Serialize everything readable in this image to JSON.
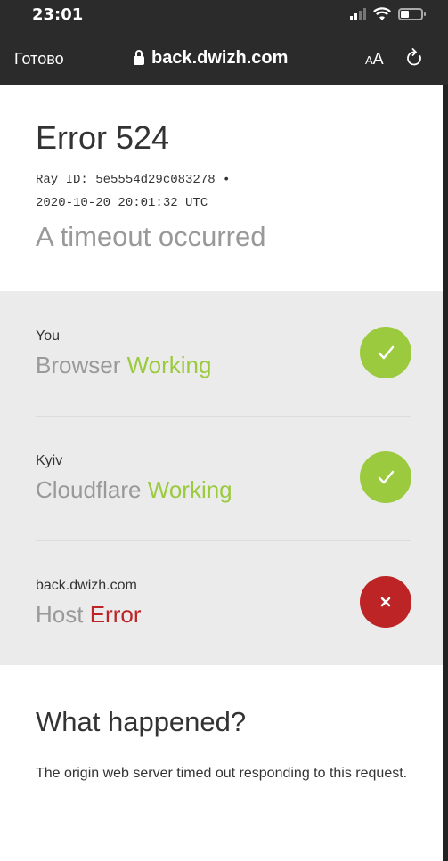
{
  "status_bar": {
    "time": "23:01",
    "icons": [
      "signal-icon",
      "wifi-icon",
      "battery-icon"
    ]
  },
  "browser": {
    "done_label": "Готово",
    "url": "back.dwizh.com",
    "text_size_label_small": "A",
    "text_size_label_large": "A",
    "icons": [
      "lock-icon",
      "reload-icon"
    ]
  },
  "error": {
    "title": "Error 524",
    "ray_id": "Ray ID: 5e5554d29c083278 •",
    "timestamp": "2020-10-20 20:01:32 UTC",
    "subtitle": "A timeout occurred"
  },
  "status_rows": [
    {
      "location": "You",
      "component": "Browser",
      "status": "Working",
      "state": "ok"
    },
    {
      "location": "Kyiv",
      "component": "Cloudflare",
      "status": "Working",
      "state": "ok"
    },
    {
      "location": "back.dwizh.com",
      "component": "Host",
      "status": "Error",
      "state": "error"
    }
  ],
  "what_happened": {
    "heading": "What happened?",
    "body": "The origin web server timed out responding to this request."
  },
  "colors": {
    "ok": "#9bca3e",
    "error": "#bd2426",
    "chrome": "#2b2b2b",
    "panel": "#ebebeb"
  }
}
